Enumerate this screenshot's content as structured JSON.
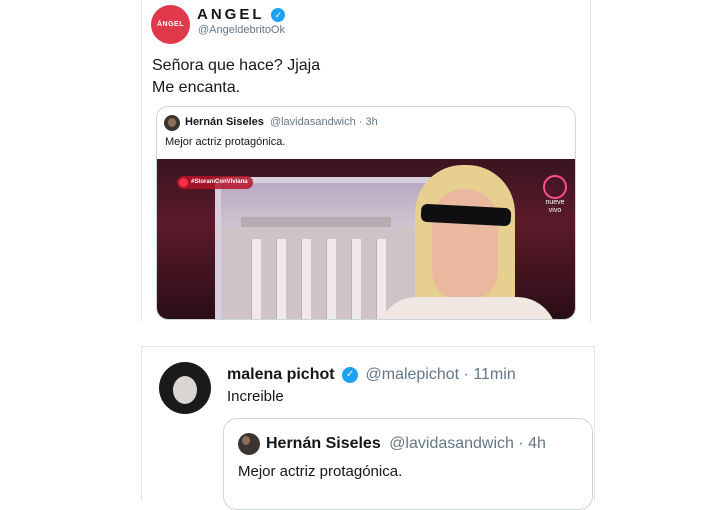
{
  "tweet_1": {
    "avatar_text": "ÁNGEL",
    "display_name": "ANGEL",
    "handle": "@AngeldebritoOk",
    "text_line_1": "Señora que hace? Jjaja",
    "text_line_2": "Me encanta.",
    "quoted": {
      "display_name": "Hernán Siseles",
      "meta": "@lavidasandwich · 3h",
      "text": "Mejor actriz protagónica.",
      "media": {
        "hashtag": "#StoraniConViviana",
        "logo_text": "nueve vivo"
      }
    }
  },
  "tweet_2": {
    "display_name": "malena pichot",
    "meta": "@malepichot · 11min",
    "text": "Increible",
    "quoted": {
      "display_name": "Hernán Siseles",
      "meta": "@lavidasandwich · 4h",
      "text": "Mejor actriz protagónica."
    }
  },
  "verified_glyph": "✓"
}
